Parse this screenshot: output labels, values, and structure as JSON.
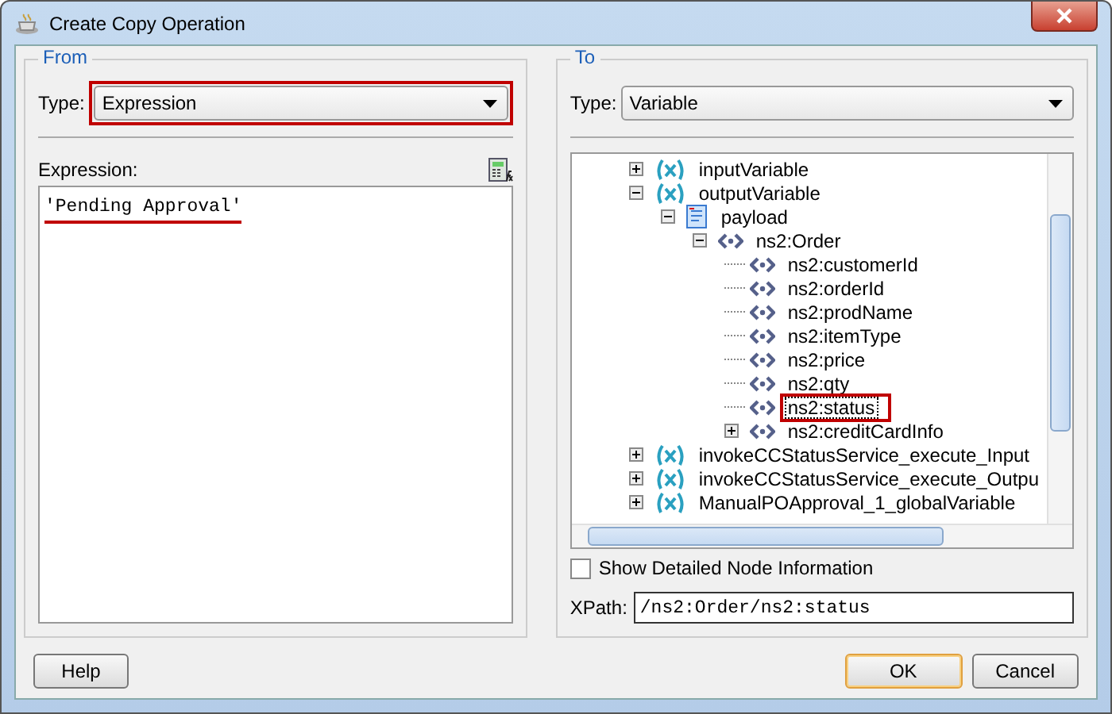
{
  "window": {
    "title": "Create Copy Operation"
  },
  "from": {
    "legend": "From",
    "type_label": "Type:",
    "type_value": "Expression",
    "type_highlighted": true,
    "expression_label": "Expression:",
    "expression_value": "'Pending Approval'",
    "expression_highlighted": true
  },
  "to": {
    "legend": "To",
    "type_label": "Type:",
    "type_value": "Variable",
    "tree": [
      {
        "label": "inputVariable",
        "kind": "variable",
        "expanded": false,
        "selected": false,
        "highlighted": false
      },
      {
        "label": "outputVariable",
        "kind": "variable",
        "expanded": true,
        "selected": false,
        "highlighted": false,
        "children": [
          {
            "label": "payload",
            "kind": "part",
            "expanded": true,
            "selected": false,
            "highlighted": false,
            "children": [
              {
                "label": "ns2:Order",
                "kind": "element",
                "expanded": true,
                "selected": false,
                "highlighted": false,
                "children": [
                  {
                    "label": "ns2:customerId",
                    "kind": "element",
                    "selected": false,
                    "highlighted": false
                  },
                  {
                    "label": "ns2:orderId",
                    "kind": "element",
                    "selected": false,
                    "highlighted": false
                  },
                  {
                    "label": "ns2:prodName",
                    "kind": "element",
                    "selected": false,
                    "highlighted": false
                  },
                  {
                    "label": "ns2:itemType",
                    "kind": "element",
                    "selected": false,
                    "highlighted": false
                  },
                  {
                    "label": "ns2:price",
                    "kind": "element",
                    "selected": false,
                    "highlighted": false
                  },
                  {
                    "label": "ns2:qty",
                    "kind": "element",
                    "selected": false,
                    "highlighted": false
                  },
                  {
                    "label": "ns2:status",
                    "kind": "element",
                    "selected": true,
                    "highlighted": true
                  },
                  {
                    "label": "ns2:creditCardInfo",
                    "kind": "element",
                    "expanded": false,
                    "selected": false,
                    "highlighted": false
                  }
                ]
              }
            ]
          }
        ]
      },
      {
        "label": "invokeCCStatusService_execute_Input",
        "kind": "variable",
        "expanded": false,
        "selected": false,
        "highlighted": false
      },
      {
        "label": "invokeCCStatusService_execute_Outpu",
        "kind": "variable",
        "expanded": false,
        "selected": false,
        "highlighted": false
      },
      {
        "label": "ManualPOApproval_1_globalVariable",
        "kind": "variable",
        "expanded": false,
        "selected": false,
        "highlighted": false
      }
    ],
    "show_detail_label": "Show Detailed Node Information",
    "show_detail_checked": false,
    "xpath_label": "XPath:",
    "xpath_value": "/ns2:Order/ns2:status"
  },
  "buttons": {
    "help": "Help",
    "ok": "OK",
    "cancel": "Cancel"
  }
}
